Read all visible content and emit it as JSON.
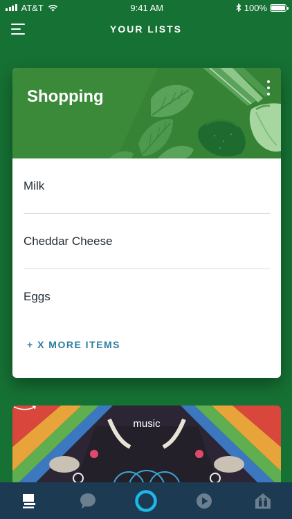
{
  "status_bar": {
    "carrier": "AT&T",
    "time": "9:41 AM",
    "battery": "100%"
  },
  "header": {
    "title": "YOUR LISTS"
  },
  "shopping_card": {
    "title": "Shopping",
    "items": [
      {
        "label": "Milk"
      },
      {
        "label": "Cheddar Cheese"
      },
      {
        "label": "Eggs"
      }
    ],
    "more_label": "+ X MORE ITEMS"
  },
  "music_card": {
    "logo": "music"
  },
  "bottom_nav": {
    "items": [
      {
        "icon": "home-icon",
        "active": true
      },
      {
        "icon": "communicate-icon",
        "active": false
      },
      {
        "icon": "alexa-icon",
        "active": false
      },
      {
        "icon": "play-icon",
        "active": false
      },
      {
        "icon": "devices-icon",
        "active": false
      }
    ]
  },
  "colors": {
    "background": "#167134",
    "banner": "#3b8a3a",
    "accent_link": "#2a7ba2",
    "nav_bar": "#1d3a53",
    "alexa_ring": "#1eb8e8"
  }
}
